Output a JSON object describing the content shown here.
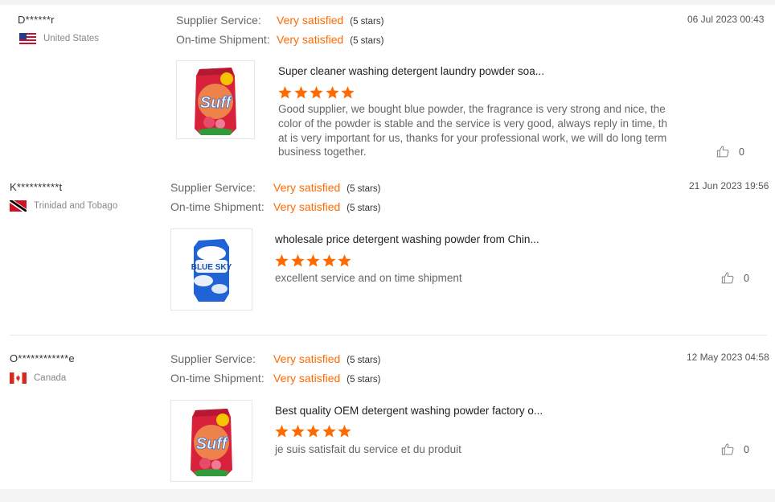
{
  "reviews": [
    {
      "user": "D******r",
      "country": "United States",
      "flag": "us-flag",
      "supplier_label": "Supplier Service:",
      "supplier_value": "Very satisfied",
      "supplier_stars": "(5 stars)",
      "shipment_label": "On-time Shipment:",
      "shipment_value": "Very satisfied",
      "shipment_stars": "(5 stars)",
      "date": "06 Jul 2023 00:43",
      "product_title": "Super cleaner washing detergent laundry powder soa...",
      "product_image": "suff-detergent-pack-image",
      "product_brand": "Suff",
      "rating": 5,
      "comment": "Good supplier, we bought blue powder, the fragrance is very strong and nice, the color of the powder is stable and the service is very good, always reply in time, that is very important for us, thanks for your professional work, we will do long term business together.",
      "likes": "0"
    },
    {
      "user": "K**********t",
      "country": "Trinidad and Tobago",
      "flag": "trinidad-flag",
      "supplier_label": "Supplier Service:",
      "supplier_value": "Very satisfied",
      "supplier_stars": "(5 stars)",
      "shipment_label": "On-time Shipment:",
      "shipment_value": "Very satisfied",
      "shipment_stars": "(5 stars)",
      "date": "21 Jun 2023 19:56",
      "product_title": "wholesale price detergent washing powder from Chin...",
      "product_image": "blue-sky-detergent-pack-image",
      "product_brand": "BLUE SKY",
      "rating": 5,
      "comment": "excellent service and on time shipment",
      "likes": "0"
    },
    {
      "user": "O************e",
      "country": "Canada",
      "flag": "canada-flag",
      "supplier_label": "Supplier Service:",
      "supplier_value": "Very satisfied",
      "supplier_stars": "(5 stars)",
      "shipment_label": "On-time Shipment:",
      "shipment_value": "Very satisfied",
      "shipment_stars": "(5 stars)",
      "date": "12 May 2023 04:58",
      "product_title": "Best quality OEM detergent washing powder factory o...",
      "product_image": "suff-detergent-pack-image",
      "product_brand": "Suff",
      "rating": 5,
      "comment": "je suis satisfait du service et du produit",
      "likes": "0"
    }
  ],
  "colors": {
    "accent": "#ff6a00",
    "star": "#ff6a00",
    "divider": "#e6e6e6",
    "muted_text": "#888888"
  },
  "icons": {
    "like": "thumbs-up-icon",
    "star": "star-icon"
  }
}
